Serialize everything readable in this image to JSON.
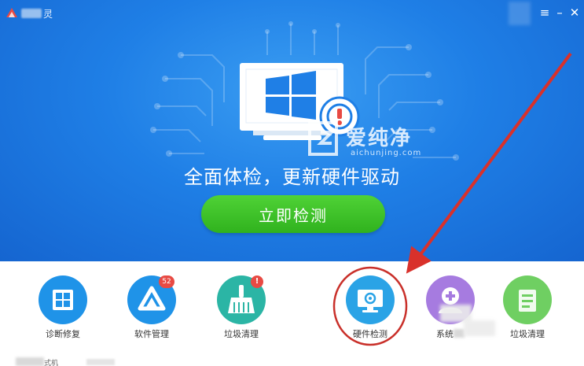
{
  "titlebar": {
    "title": "灵",
    "menu_icon": "hamburger-menu-icon",
    "minimize_icon": "minimize-icon",
    "close_icon": "close-icon"
  },
  "hero": {
    "slogan": "全面体检，更新硬件驱动",
    "start_button": "立即检测"
  },
  "watermark": {
    "text": "爱纯净",
    "url": "aichunjing.com"
  },
  "tools": [
    {
      "label": "诊断修复",
      "icon": "windows-repair-icon",
      "color": "#1f93e8"
    },
    {
      "label": "软件管理",
      "icon": "software-manager-icon",
      "color": "#1f93e8",
      "badge": "52"
    },
    {
      "label": "垃圾清理",
      "icon": "broom-icon",
      "color": "#2bb5a5",
      "badge": "!"
    },
    {
      "label": "硬件检测",
      "icon": "monitor-gear-icon",
      "color": "#2aa3e6"
    },
    {
      "label": "系统",
      "icon": "system-doctor-icon",
      "color": "#a67be0"
    },
    {
      "label": "垃圾清理",
      "icon": "cleanup-icon",
      "color": "#6fcf62"
    }
  ],
  "statusbar": {
    "text": "式机"
  },
  "colors": {
    "hero_blue": "#1f7fe6",
    "button_green": "#3cc028",
    "annotation_red": "#d9312b",
    "badge_red": "#e84a43"
  }
}
